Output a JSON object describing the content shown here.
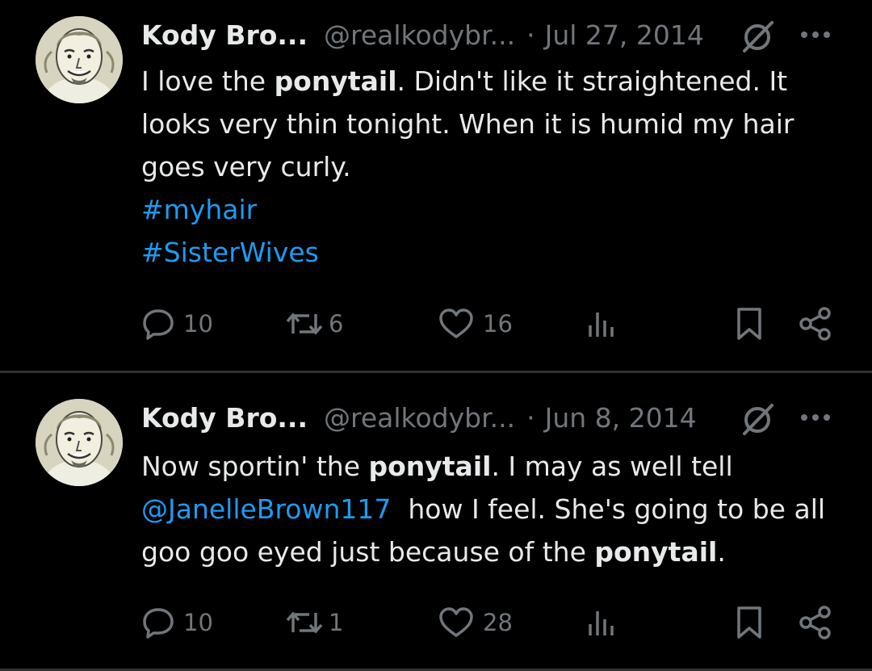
{
  "tweets": [
    {
      "name": "Kody Bro...",
      "handle": "@realkodybr...",
      "separator": "·",
      "date": "Jul 27, 2014",
      "text_parts": [
        "I love the ",
        "ponytail",
        ". Didn't like it straightened. It looks very thin tonight. When it is humid my hair goes very curly."
      ],
      "hashtags": [
        "#myhair",
        "#SisterWives"
      ],
      "replies": "10",
      "reposts": "6",
      "likes": "16"
    },
    {
      "name": "Kody Bro...",
      "handle": "@realkodybr...",
      "separator": "·",
      "date": "Jun 8, 2014",
      "text_parts": [
        "Now sportin' the ",
        "ponytail",
        ". I may as well tell ",
        "@JanelleBrown117",
        "  how I feel. She's going to be all goo goo eyed just because of the ",
        "ponytail",
        "."
      ],
      "replies": "10",
      "reposts": "1",
      "likes": "28"
    }
  ],
  "icons": {
    "reply": "speech-bubble-icon",
    "repost": "repost-arrows-icon",
    "like": "heart-icon",
    "views": "bar-chart-icon",
    "bookmark": "bookmark-icon",
    "share": "share-nodes-icon",
    "grok": "slashed-circle-icon",
    "more": "ellipsis-icon"
  },
  "colors": {
    "background": "#000000",
    "text": "#e7e9ea",
    "muted": "#71767b",
    "link": "#1d9bf0",
    "divider": "#2f3336"
  }
}
